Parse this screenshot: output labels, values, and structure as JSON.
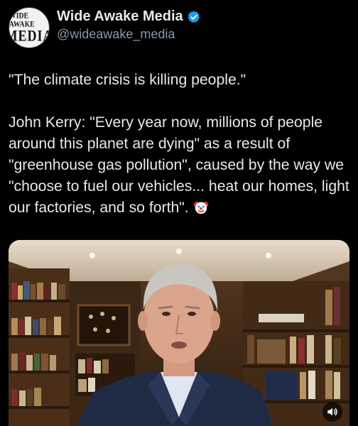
{
  "author": {
    "display_name": "Wide Awake Media",
    "handle": "@wideawake_media",
    "avatar_text_top": "WIDE AWAKE",
    "avatar_text_bottom": "MEDIA",
    "verified_color": "#1d9bf0"
  },
  "tweet": {
    "quote_line": "\"The climate crisis is killing people.\"",
    "body": "John Kerry: \"Every year now, millions of people around this planet are dying\" as a result of \"greenhouse gas pollution\", caused by the way we \"choose to fuel our vehicles... heat our homes, light our factories, and so forth\". ",
    "emoji": "clown-face"
  },
  "media": {
    "type": "video",
    "sound_icon": "speaker-icon"
  }
}
